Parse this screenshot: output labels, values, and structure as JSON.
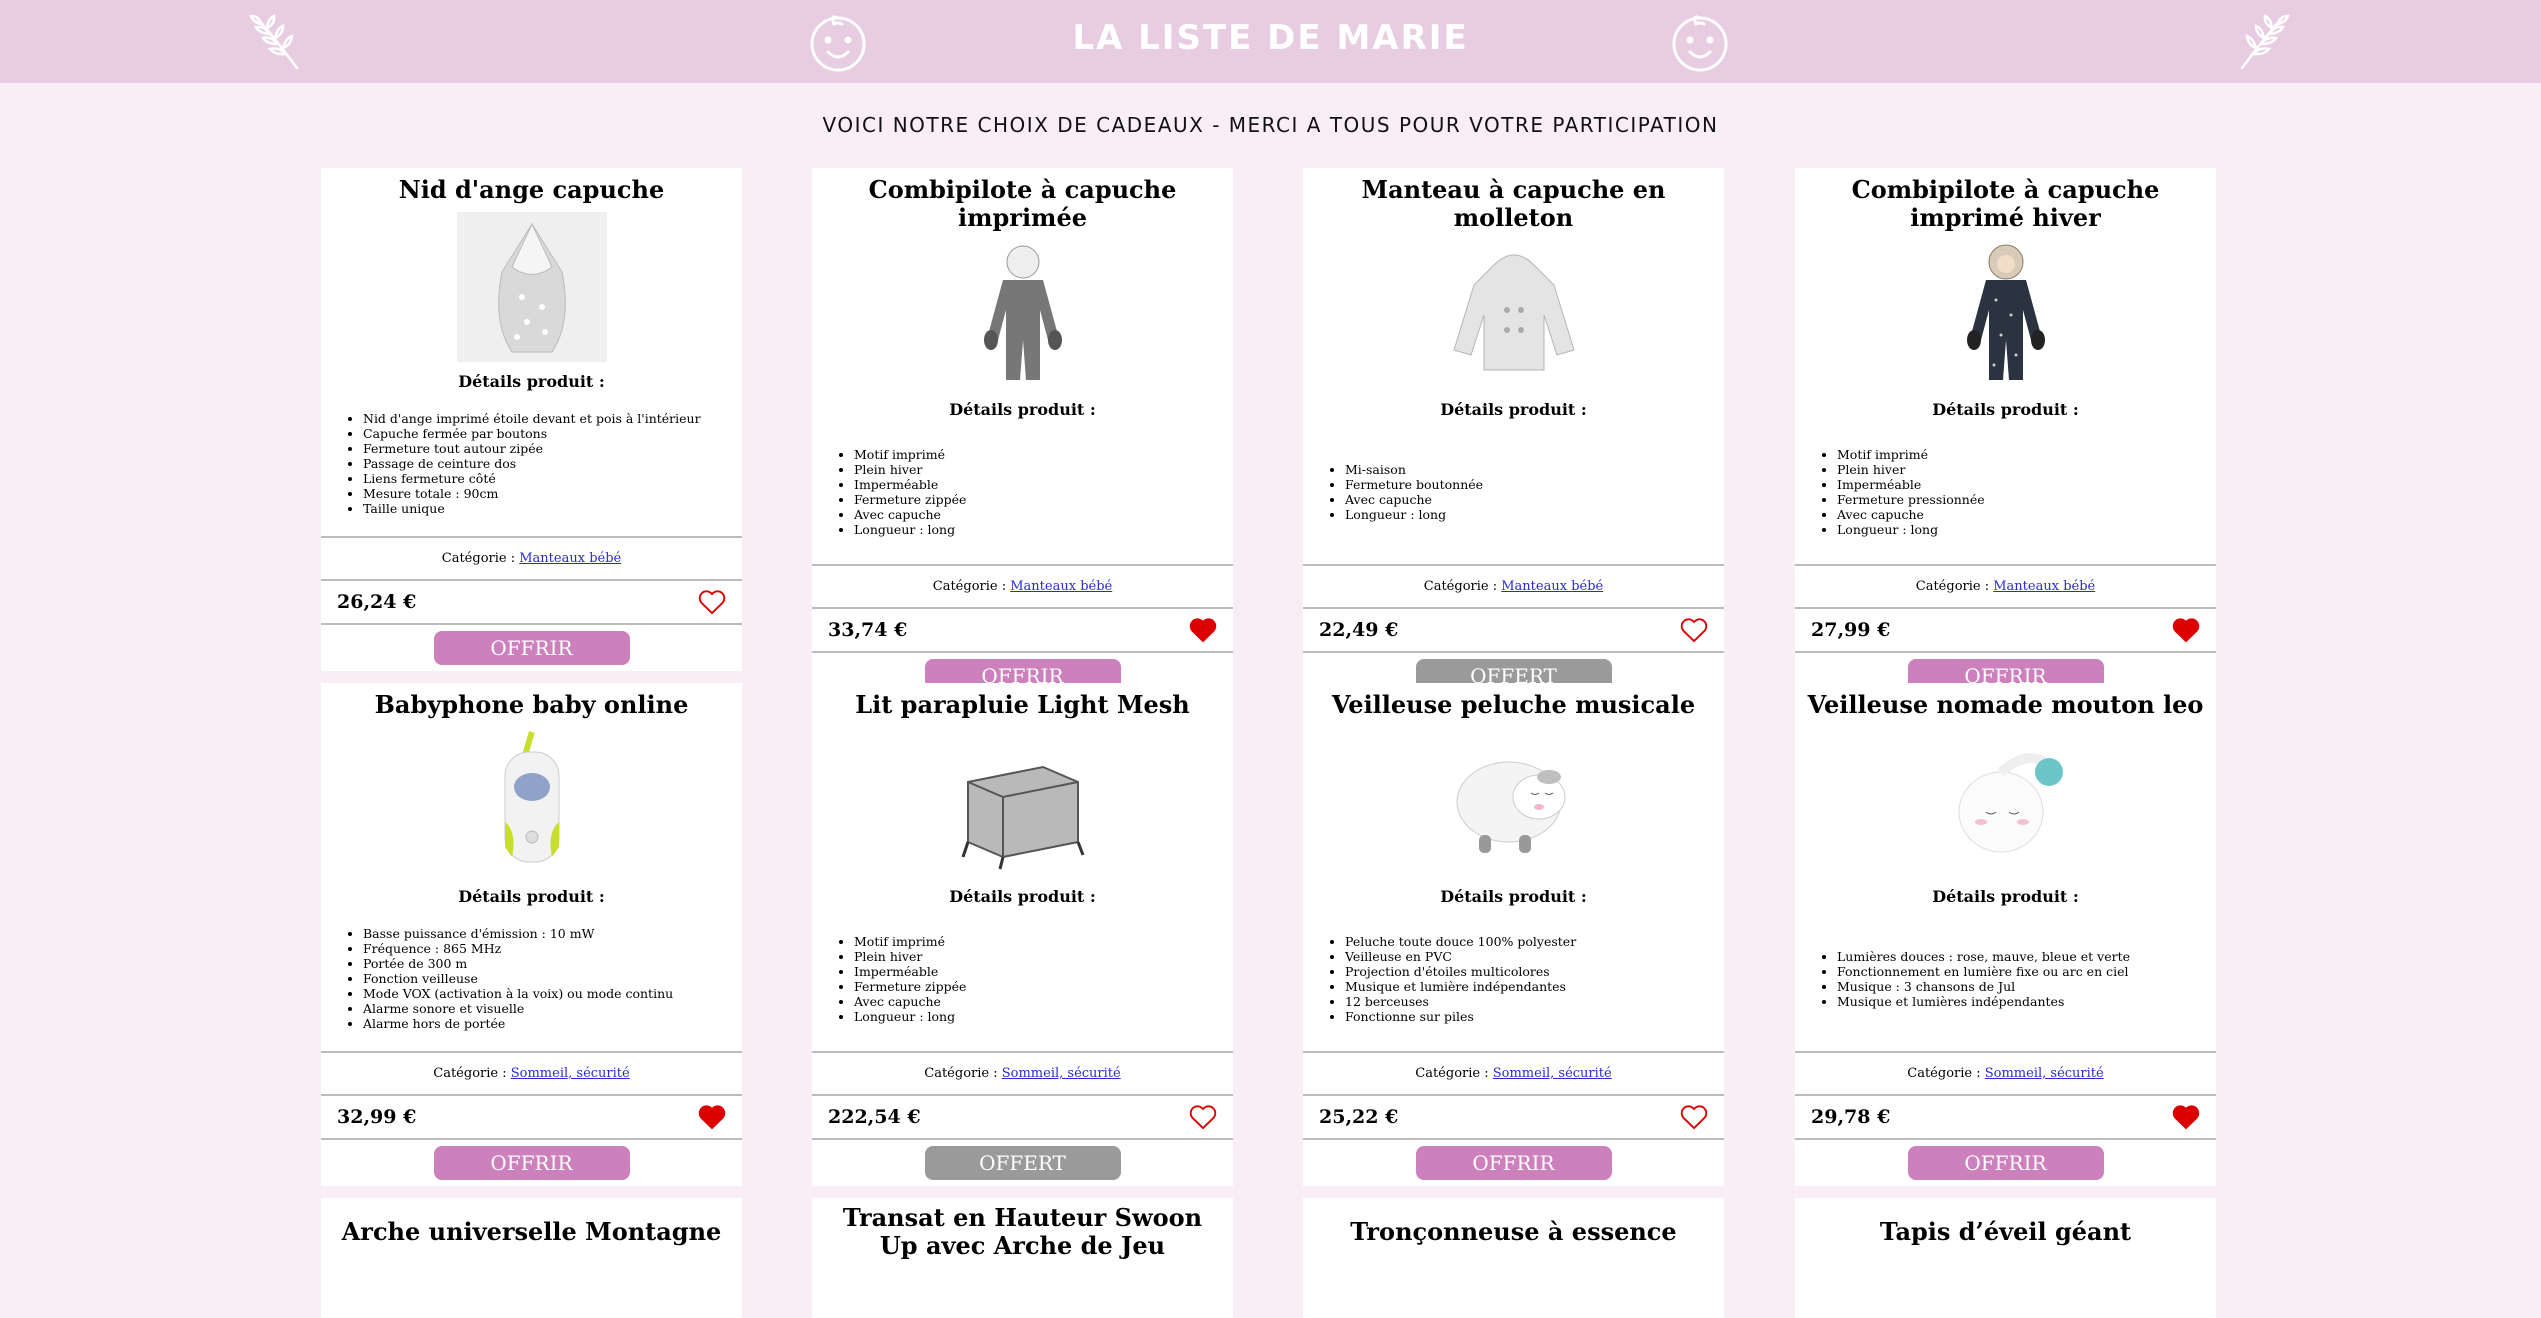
{
  "header": {
    "title": "LA LISTE DE MARIE"
  },
  "subtitle": "VOICI NOTRE CHOIX DE CADEAUX - MERCI A TOUS POUR VOTRE PARTICIPATION",
  "details_label": "Détails produit :",
  "category_prefix": "Catégorie : ",
  "colors": {
    "header_bg": "#e8cde2",
    "page_bg": "#faeef6",
    "offrir": "#cc80bc",
    "offert": "#9a9a9a",
    "heart": "#dd0000"
  },
  "products": [
    {
      "name": "Nid d'ange capuche",
      "icon": "baby-nest-image",
      "details": [
        "Nid d'ange imprimé étoile devant et pois à l'intérieur",
        "Capuche fermée par boutons",
        "Fermeture tout autour zipée",
        "Passage de ceinture dos",
        "Liens fermeture côté",
        "Mesure totale : 90cm",
        "Taille unique"
      ],
      "category": "Manteaux bébé",
      "price": "26,24 €",
      "favorited": false,
      "button": "OFFRIR",
      "state": "offrir"
    },
    {
      "name": "Combipilote à capuche imprimée",
      "icon": "grey-snowsuit-image",
      "details": [
        "Motif imprimé",
        "Plein hiver",
        "Imperméable",
        "Fermeture zippée",
        "Avec capuche",
        "Longueur : long"
      ],
      "category": "Manteaux bébé",
      "price": "33,74 €",
      "favorited": true,
      "button": "OFFRIR",
      "state": "offrir"
    },
    {
      "name": "Manteau à capuche en molleton",
      "icon": "white-coat-image",
      "details": [
        "Mi-saison",
        "Fermeture boutonnée",
        "Avec capuche",
        "Longueur : long"
      ],
      "category": "Manteaux bébé",
      "price": "22,49 €",
      "favorited": false,
      "button": "OFFERT",
      "state": "offert"
    },
    {
      "name": "Combipilote à capuche imprimé hiver",
      "icon": "navy-snowsuit-image",
      "details": [
        "Motif imprimé",
        "Plein hiver",
        "Imperméable",
        "Fermeture pressionnée",
        "Avec capuche",
        "Longueur : long"
      ],
      "category": "Manteaux bébé",
      "price": "27,99 €",
      "favorited": true,
      "button": "OFFRIR",
      "state": "offrir"
    },
    {
      "name": "Babyphone baby online",
      "icon": "babyphone-image",
      "details": [
        "Basse puissance d'émission : 10 mW",
        "Fréquence : 865 MHz",
        "Portée de 300 m",
        "Fonction veilleuse",
        "Mode VOX (activation à la voix) ou mode continu",
        "Alarme sonore et visuelle",
        "Alarme hors de portée"
      ],
      "category": "Sommeil, sécurité",
      "price": "32,99 €",
      "favorited": true,
      "button": "OFFRIR",
      "state": "offrir"
    },
    {
      "name": "Lit parapluie Light Mesh",
      "icon": "travel-cot-image",
      "details": [
        "Motif imprimé",
        "Plein hiver",
        "Imperméable",
        "Fermeture zippée",
        "Avec capuche",
        "Longueur : long"
      ],
      "category": "Sommeil, sécurité",
      "price": "222,54 €",
      "favorited": false,
      "button": "OFFERT",
      "state": "offert"
    },
    {
      "name": "Veilleuse peluche musicale",
      "icon": "sheep-nightlight-image",
      "details": [
        "Peluche toute douce 100% polyester",
        "Veilleuse en PVC",
        "Projection d'étoiles multicolores",
        "Musique et lumière indépendantes",
        "12 berceuses",
        "Fonctionne sur piles"
      ],
      "category": "Sommeil, sécurité",
      "price": "25,22 €",
      "favorited": false,
      "button": "OFFRIR",
      "state": "offrir"
    },
    {
      "name": "Veilleuse nomade mouton leo",
      "icon": "nomad-nightlight-image",
      "details": [
        "Lumières douces : rose, mauve, bleue et verte",
        "Fonctionnement en lumière fixe ou arc en ciel",
        "Musique : 3 chansons de Jul",
        "Musique et lumières indépendantes"
      ],
      "category": "Sommeil, sécurité",
      "price": "29,78 €",
      "favorited": true,
      "button": "OFFRIR",
      "state": "offrir"
    }
  ],
  "next_row": [
    {
      "name": "Arche universelle Montagne"
    },
    {
      "name": "Transat en Hauteur Swoon Up avec Arche de Jeu"
    },
    {
      "name": "Tronçonneuse à essence"
    },
    {
      "name": "Tapis d’éveil géant"
    }
  ]
}
